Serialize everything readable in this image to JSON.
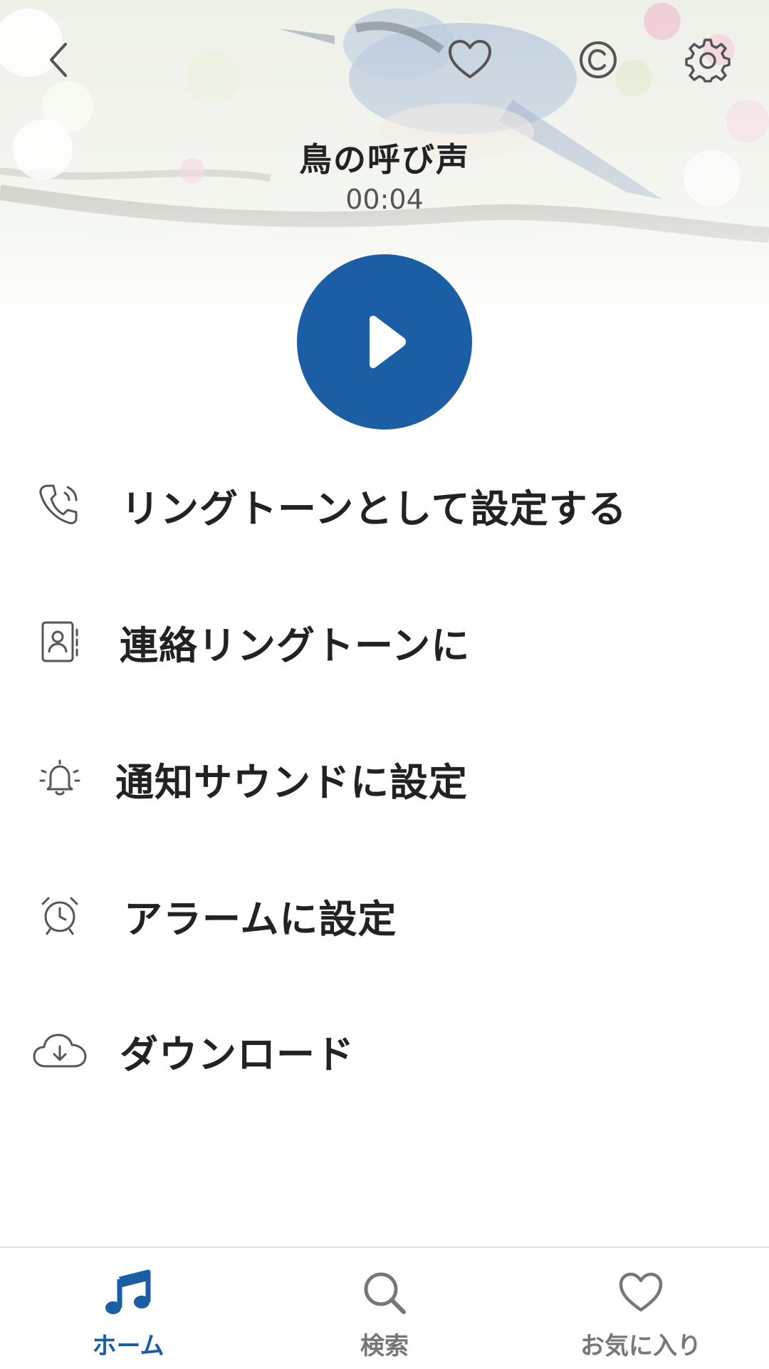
{
  "header": {
    "title": "鳥の呼び声",
    "duration": "00:04"
  },
  "icons": {
    "back": "chevron-left-icon",
    "favorite": "heart-outline-icon",
    "copyright": "copyright-icon",
    "settings": "gear-icon",
    "play": "play-icon"
  },
  "actions": [
    {
      "label": "リングトーンとして設定する",
      "icon": "ringing-phone-icon"
    },
    {
      "label": "連絡リングトーンに",
      "icon": "contact-card-icon"
    },
    {
      "label": "通知サウンドに設定",
      "icon": "bell-icon"
    },
    {
      "label": "アラームに設定",
      "icon": "alarm-clock-icon"
    },
    {
      "label": "ダウンロード",
      "icon": "cloud-download-icon"
    }
  ],
  "bottom_nav": {
    "items": [
      {
        "label": "ホーム",
        "icon": "music-note-icon",
        "active": true
      },
      {
        "label": "検索",
        "icon": "search-icon",
        "active": false
      },
      {
        "label": "お気に入り",
        "icon": "heart-outline-icon",
        "active": false
      }
    ]
  },
  "colors": {
    "accent": "#1b5ea6",
    "text": "#222222",
    "inactive": "#777777"
  }
}
